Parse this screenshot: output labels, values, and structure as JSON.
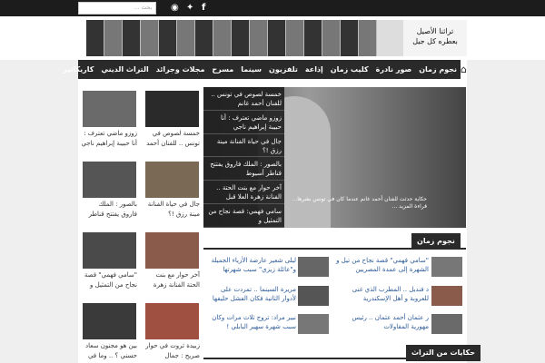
{
  "topbar": {
    "search_placeholder": "بحث ...",
    "social": [
      "facebook-icon",
      "twitter-icon",
      "rss-icon"
    ]
  },
  "banner": {
    "slogan_line1": "تراثنا الأصيل",
    "slogan_line2": "بعطره كل جيل"
  },
  "nav": {
    "items": [
      "نجوم زمان",
      "صور نادرة",
      "كليب زمان",
      "إذاعة",
      "تلفزيون",
      "سينما",
      "مسرح",
      "مجلات وجرائد",
      "التراث الديني",
      "كاريكاتير"
    ]
  },
  "slider": {
    "caption": "حكاية حدثت للفنان أحمد غانم عندما كان في تونس نشرها... قراءة المزيد ...",
    "items": [
      "خمسة لصوص في تونس .. للفنان أحمد غانم",
      "زوزو ماضي تعترف : أنا حبيبة إبراهيم ناجي",
      "جال في حياة الفنانة مينة رزق !؟",
      "بالصور : الملك فاروق يفتتح قناطر أسيوط",
      "آخر حوار مع بنت الحتة .. الفنانة زهرة العلا قبل",
      "سامي فهمي: قصة نجاح من التمثيل و"
    ]
  },
  "sidebar": {
    "items": [
      "خمسة لصوص في تونس .. للفنان أحمد",
      "زوزو ماضي تعترف : أنا حبيبة إبراهيم ناجي",
      "جال في حياة الفنانة مينة رزق !؟",
      "بالصور : الملك فاروق يفتتح قناطر",
      "آخر حوار مع بنت الحتة الفنانة زهرة",
      "\"سامي فهمي\" قصة نجاح من التمثيل و",
      "زبيدة ثروت في حوار صريح : جمال",
      "بين هو مجنون سعاد حسني ؟ .. وما في"
    ]
  },
  "section_stars": {
    "title": "نجوم زمان",
    "news": [
      "\"سامي فهمي\" قصة نجاح من تيل و الشهرة إلى عمدة المصريين",
      "ليلى شعير عارضة الأزياء الجميلة و\"عائلة زيزي\" سبب شهرتها",
      "د فنديل .. المطرب الذي غنى للعروبة و أهل الإسكندرية",
      "مريرة السينما .. تمردت على لأدوار الثانية فكان الفشل حليفها",
      "ر عثمان أحمد عثمان .. رئيس مهورية المقاولات",
      "نبير مراد: تروج ثلاث مرات وكان سبب شهرة سهير البابلي !"
    ]
  },
  "section_heritage": {
    "title": "حكايات من التراث"
  }
}
